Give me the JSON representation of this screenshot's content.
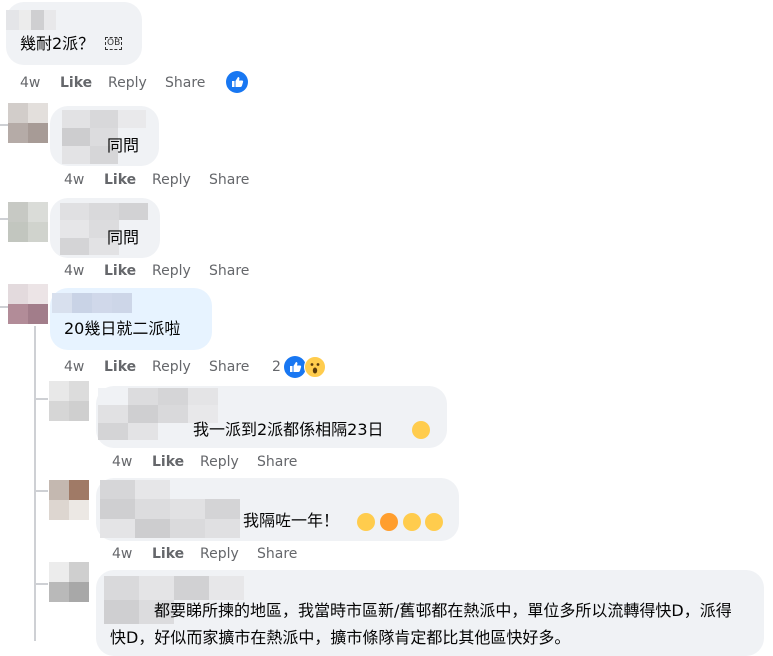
{
  "colors": {
    "bubble": "#f0f2f5",
    "bubble_highlight": "#e7f3ff",
    "action_text": "#65676b",
    "like_blue": "#1877f2",
    "emoji_yellow": "#ffcc4d"
  },
  "actions": {
    "time": "4w",
    "like": "Like",
    "reply": "Reply",
    "share": "Share"
  },
  "comments": [
    {
      "text": "幾耐2派？",
      "badge": "OB"
    },
    {
      "text": "同問"
    },
    {
      "text": "同問"
    },
    {
      "text": "20幾日就二派啦",
      "reaction_count": "2"
    },
    {
      "text": "我一派到2派都係相隔23日"
    },
    {
      "text": "我隔咗一年！"
    },
    {
      "text": "都要睇所揀的地區，我當時市區新/舊邨都在熱派中，單位多所以流轉得快D，派得快D，好似而家擴市在熱派中，擴市條隊肯定都比其他區快好多。"
    }
  ]
}
